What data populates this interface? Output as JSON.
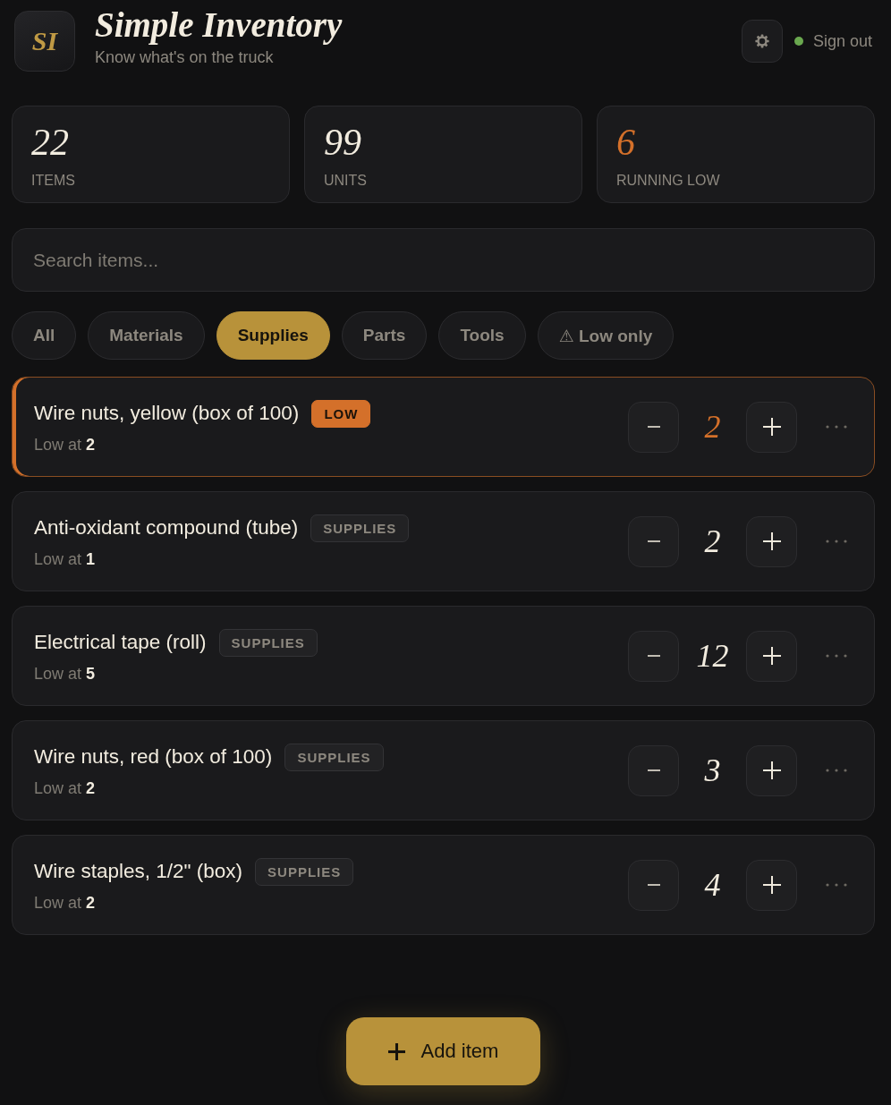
{
  "header": {
    "logo": "SI",
    "title": "Simple Inventory",
    "subtitle": "Know what's on the truck"
  },
  "session": {
    "online": true,
    "label": "Sign out"
  },
  "stats": [
    {
      "value": "22",
      "label": "ITEMS",
      "alert": false
    },
    {
      "value": "99",
      "label": "UNITS",
      "alert": false
    },
    {
      "value": "6",
      "label": "RUNNING LOW",
      "alert": true
    }
  ],
  "search": {
    "placeholder": "Search items..."
  },
  "filters": [
    {
      "label": "All",
      "selected": false
    },
    {
      "label": "Materials",
      "selected": false
    },
    {
      "label": "Supplies",
      "selected": true
    },
    {
      "label": "Parts",
      "selected": false
    },
    {
      "label": "Tools",
      "selected": false
    },
    {
      "label": "⚠ Low only",
      "selected": false
    }
  ],
  "items": [
    {
      "name": "Wire nuts, yellow (box of 100)",
      "badge": "LOW",
      "low": true,
      "note": "Low at **2**",
      "quantity": "2"
    },
    {
      "name": "Anti-oxidant compound (tube)",
      "badge": "SUPPLIES",
      "low": false,
      "note": "Low at **1**",
      "quantity": "2"
    },
    {
      "name": "Electrical tape (roll)",
      "badge": "SUPPLIES",
      "low": false,
      "note": "Low at **5**",
      "quantity": "12"
    },
    {
      "name": "Wire nuts, red (box of 100)",
      "badge": "SUPPLIES",
      "low": false,
      "note": "Low at **2**",
      "quantity": "3"
    },
    {
      "name": "Wire staples, 1/2\" (box)",
      "badge": "SUPPLIES",
      "low": false,
      "note": "Low at **2**",
      "quantity": "4"
    }
  ],
  "add_button": {
    "label": "Add item"
  }
}
